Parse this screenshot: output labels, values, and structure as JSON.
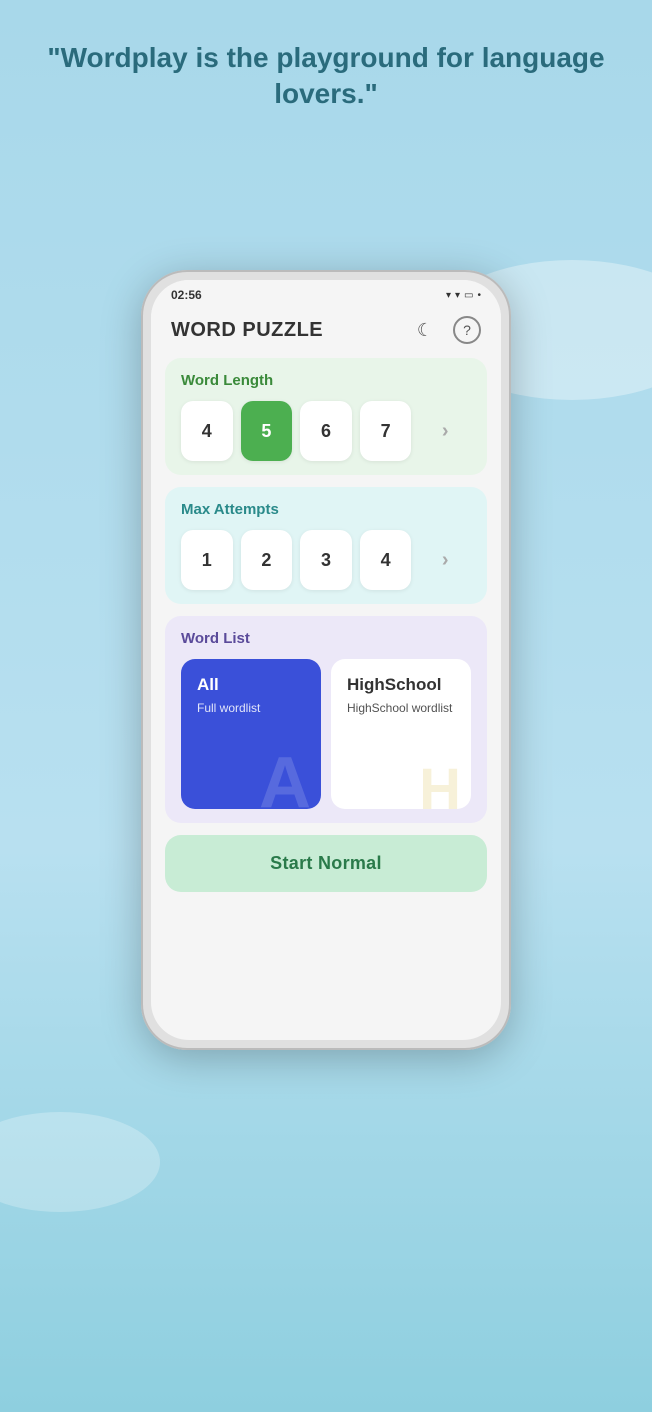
{
  "page": {
    "background_color": "#a8d8ea",
    "headline": "\"Wordplay is the playground for language lovers.\""
  },
  "status_bar": {
    "time": "02:56",
    "left_icons": "◂ • ⊙ ⏷ •",
    "right_icons": "✦ 膕 ▾ ⬛ •"
  },
  "app_header": {
    "title": "WORD PUZZLE",
    "dark_mode_icon": "☾",
    "help_icon": "?"
  },
  "word_length": {
    "section_title": "Word Length",
    "options": [
      {
        "value": "4",
        "selected": false
      },
      {
        "value": "5",
        "selected": true
      },
      {
        "value": "6",
        "selected": false
      },
      {
        "value": "7",
        "selected": false
      }
    ],
    "more": "›"
  },
  "max_attempts": {
    "section_title": "Max Attempts",
    "options": [
      {
        "value": "1",
        "selected": false
      },
      {
        "value": "2",
        "selected": false
      },
      {
        "value": "3",
        "selected": false
      },
      {
        "value": "4",
        "selected": false
      }
    ],
    "more": "›"
  },
  "word_list": {
    "section_title": "Word List",
    "cards": [
      {
        "id": "all",
        "title": "All",
        "subtitle": "Full wordlist",
        "watermark": "A",
        "selected": true
      },
      {
        "id": "highschool",
        "title": "HighSchool",
        "subtitle": "HighSchool wordlist",
        "watermark": "H",
        "selected": false
      }
    ]
  },
  "start_button": {
    "label": "Start Normal"
  }
}
